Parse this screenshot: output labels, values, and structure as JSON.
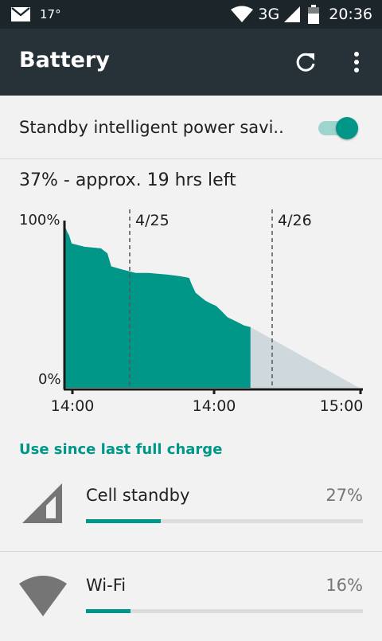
{
  "status_bar": {
    "temperature": "17°",
    "network": "3G",
    "time": "20:36",
    "icons": [
      "email-icon",
      "wifi-icon",
      "signal-icon",
      "battery-icon"
    ]
  },
  "app_bar": {
    "title": "Battery",
    "icons": [
      "refresh-icon",
      "more-options-icon"
    ]
  },
  "power_saving": {
    "label": "Standby intelligent power savi..",
    "enabled": true
  },
  "summary": "37% - approx. 19 hrs left",
  "chart_data": {
    "type": "area",
    "y_ticks": [
      "100%",
      "0%"
    ],
    "x_ticks": [
      "14:00",
      "14:00",
      "15:00"
    ],
    "day_markers": [
      "4/25",
      "4/26"
    ],
    "ylim": [
      0,
      100
    ],
    "series": [
      {
        "values": [
          [
            0,
            98
          ],
          [
            1.5,
            95
          ],
          [
            3,
            93
          ],
          [
            5,
            88
          ],
          [
            15,
            86
          ],
          [
            28,
            85
          ],
          [
            33,
            82
          ],
          [
            36,
            74
          ],
          [
            45,
            72
          ],
          [
            55,
            70
          ],
          [
            65,
            70
          ],
          [
            80,
            69
          ],
          [
            90,
            68
          ],
          [
            97,
            67
          ],
          [
            99,
            63
          ],
          [
            102,
            58
          ],
          [
            105,
            56
          ],
          [
            110,
            53
          ],
          [
            115,
            51
          ],
          [
            118,
            50
          ],
          [
            122,
            47
          ],
          [
            127,
            43
          ],
          [
            135,
            40
          ],
          [
            140,
            38
          ],
          [
            145,
            37
          ]
        ]
      },
      {
        "values": [
          [
            145,
            37
          ],
          [
            230,
            0
          ]
        ]
      }
    ],
    "colors": {
      "history": "#009688",
      "estimate": "#cfd8dc"
    },
    "grid": false
  },
  "section_title": "Use since last full charge",
  "usage": [
    {
      "name": "Cell standby",
      "percent": "27%",
      "fraction": 0.27,
      "icon": "cell-signal-icon"
    },
    {
      "name": "Wi-Fi",
      "percent": "16%",
      "fraction": 0.16,
      "icon": "wifi-icon"
    }
  ],
  "colors": {
    "accent": "#009688",
    "appbar": "#263238",
    "statusbar": "#1c2529"
  }
}
